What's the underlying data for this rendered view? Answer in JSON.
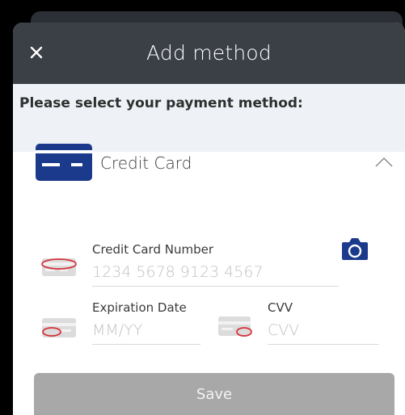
{
  "header": {
    "title": "Add method",
    "close_icon": "close-icon"
  },
  "section": {
    "label": "Please select your payment method:"
  },
  "method": {
    "label": "Credit Card",
    "icon": "credit-card-icon",
    "expand_icon": "chevron-up-icon"
  },
  "fields": {
    "card_number": {
      "label": "Credit Card Number",
      "placeholder": "1234 5678 9123 4567"
    },
    "expiration": {
      "label": "Expiration Date",
      "placeholder": "MM/YY"
    },
    "cvv": {
      "label": "CVV",
      "placeholder": "CVV"
    }
  },
  "camera": {
    "icon": "camera-icon"
  },
  "save": {
    "label": "Save"
  },
  "colors": {
    "header_bg": "#3b3f46",
    "section_bg": "#eef2f6",
    "card_blue": "#1b3a8c",
    "hint_red": "#d6333a",
    "save_bg": "#a8a8a8"
  }
}
